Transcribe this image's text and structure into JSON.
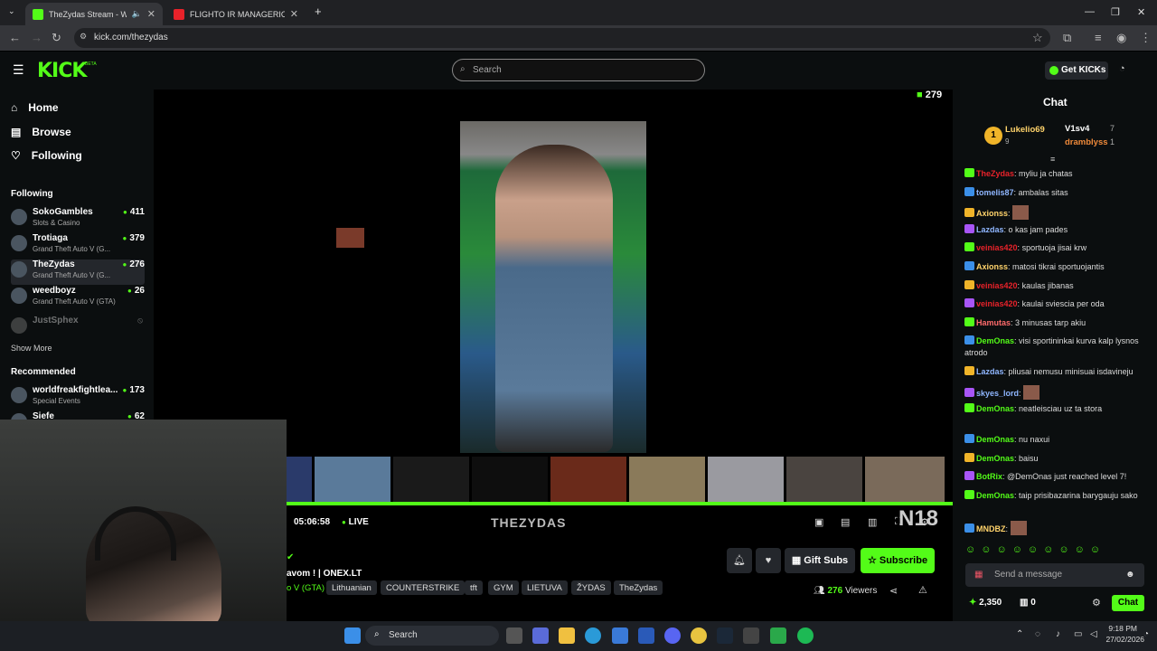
{
  "browser": {
    "tabs": [
      {
        "title": "TheZydas Stream - Watch Li",
        "color": "#53fc18"
      },
      {
        "title": "FLIGHTO IR MANAGERIO PIRM",
        "color": "#e8222a"
      }
    ],
    "url": "kick.com/thezydas"
  },
  "header": {
    "logo": "KICK",
    "beta": "BETA",
    "search_placeholder": "Search",
    "get_kicks": "Get KICKs"
  },
  "sidebar": {
    "nav": [
      {
        "label": "Home",
        "icon": "home-icon"
      },
      {
        "label": "Browse",
        "icon": "browse-icon"
      },
      {
        "label": "Following",
        "icon": "heart-icon"
      }
    ],
    "following_title": "Following",
    "following": [
      {
        "name": "SokoGambles",
        "game": "Slots & Casino",
        "viewers": "411"
      },
      {
        "name": "Trotiaga",
        "game": "Grand Theft Auto V (G...",
        "viewers": "379"
      },
      {
        "name": "TheZydas",
        "game": "Grand Theft Auto V (G...",
        "viewers": "276"
      },
      {
        "name": "weedboyz",
        "game": "Grand Theft Auto V (GTA)",
        "viewers": "26"
      }
    ],
    "offline": "JustSphex",
    "show_more": "Show More",
    "recommended_title": "Recommended",
    "recommended": [
      {
        "name": "worldfreakfightlea...",
        "game": "Special Events",
        "viewers": "173"
      },
      {
        "name": "Siefe",
        "game": "",
        "viewers": "62"
      }
    ]
  },
  "player": {
    "viewer_badge": "279",
    "time": "05:06:58",
    "live": "LIVE",
    "streamer_overlay": "THEZYDAS",
    "corner_label": "N18"
  },
  "info": {
    "title": "avom ! | ONEX.LT",
    "category": "o V (GTA)",
    "tags": [
      "Lithuanian",
      "COUNTERSTRIKE",
      "tft",
      "GYM",
      "LIETUVA",
      "ŽYDAS",
      "TheZydas"
    ],
    "gift_subs": "Gift Subs",
    "subscribe": "Subscribe",
    "viewers": "276",
    "viewers_label": "Viewers"
  },
  "chat": {
    "title": "Chat",
    "leaderboard": [
      {
        "name": "Lukelio69",
        "count": "9"
      },
      {
        "name": "V1sv4",
        "count": "7"
      },
      {
        "name": "dramblyss",
        "count": "1"
      }
    ],
    "messages": [
      {
        "user": "TheZydas",
        "text": "myliu ja chatas",
        "color": "#e8222a"
      },
      {
        "user": "tomelis87",
        "text": "ambalas sitas",
        "color": "#8fb6ff"
      },
      {
        "user": "Axionss",
        "text": "",
        "color": "#ffd36b"
      },
      {
        "user": "Lazdas",
        "text": "o kas jam pades",
        "color": "#8fb6ff"
      },
      {
        "user": "veinias420",
        "text": "sportuoja jisai krw",
        "color": "#e8222a"
      },
      {
        "user": "Axionss",
        "text": "matosi tikrai sportuojantis",
        "color": "#ffd36b"
      },
      {
        "user": "veinias420",
        "text": "kaulas jibanas",
        "color": "#e8222a"
      },
      {
        "user": "veinias420",
        "text": "kaulai sviescia per oda",
        "color": "#e8222a"
      },
      {
        "user": "Hamutas",
        "text": "3 minusas tarp akiu",
        "color": "#ff6b6b"
      },
      {
        "user": "DemOnas",
        "text": "visi sportininkai kurva kalp lysnos atrodo",
        "color": "#53fc18"
      },
      {
        "user": "Lazdas",
        "text": "pliusai nemusu minisuai isdavineju",
        "color": "#8fb6ff"
      },
      {
        "user": "skyes_lord",
        "text": "",
        "color": "#8fb6ff"
      },
      {
        "user": "DemOnas",
        "text": "neatleisciau uz ta stora",
        "color": "#53fc18"
      },
      {
        "user": "DemOnas",
        "text": "nu naxui",
        "color": "#53fc18"
      },
      {
        "user": "DemOnas",
        "text": "baisu",
        "color": "#53fc18"
      },
      {
        "user": "BotRix",
        "text": "@DemOnas just reached level 7!",
        "color": "#53fc18"
      },
      {
        "user": "DemOnas",
        "text": "taip prisibazarina barygauju sako",
        "color": "#53fc18"
      },
      {
        "user": "MNDBZ",
        "text": "",
        "color": "#ffd36b"
      }
    ],
    "input_placeholder": "Send a message",
    "points": "2,350",
    "gifts": "0",
    "send": "Chat"
  },
  "taskbar": {
    "search": "Search",
    "time": "9:18 PM",
    "date": "27/02/2026"
  }
}
